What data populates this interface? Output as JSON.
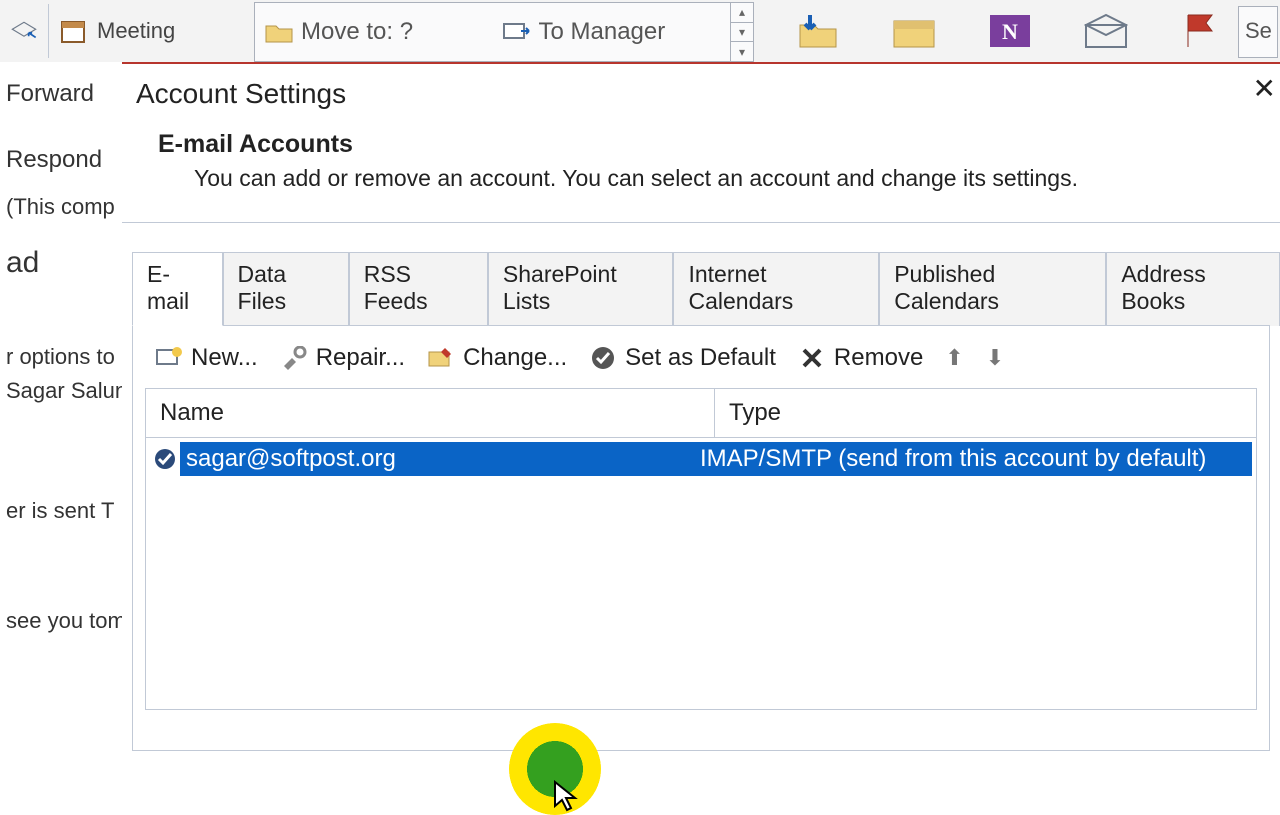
{
  "ribbon": {
    "forward_label": "Forward",
    "meeting_label": "Meeting",
    "respond_group": "Respond",
    "qs_move_label": "Move to: ?",
    "qs_manager_label": "To Manager",
    "se_label": "Se"
  },
  "bgleft": {
    "line1": " (This comp",
    "line2": "ad",
    "line3": "r options to",
    "line4": "Sagar Salunk",
    "line5": "er is sent   T",
    "line6": "see you tom"
  },
  "dialog": {
    "title": "Account Settings",
    "heading": "E-mail Accounts",
    "text": "You can add or remove an account. You can select an account and change its settings."
  },
  "tabs": {
    "email": "E-mail",
    "datafiles": "Data Files",
    "rss": "RSS Feeds",
    "sp": "SharePoint Lists",
    "ical": "Internet Calendars",
    "pcal": "Published Calendars",
    "abook": "Address Books"
  },
  "toolbar": {
    "new_label": "New...",
    "repair_label": "Repair...",
    "change_label": "Change...",
    "default_label": "Set as Default",
    "remove_label": "Remove"
  },
  "list": {
    "col_name": "Name",
    "col_type": "Type",
    "rows": [
      {
        "name": "sagar@softpost.org",
        "type": "IMAP/SMTP (send from this account by default)"
      }
    ]
  }
}
